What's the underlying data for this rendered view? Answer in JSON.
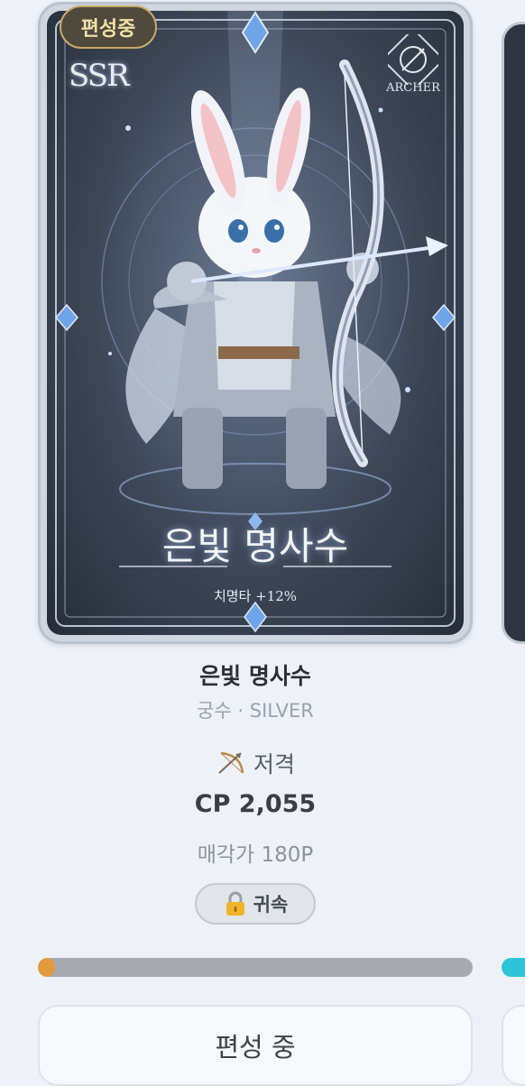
{
  "card": {
    "badge": "편성중",
    "rarity": "SSR",
    "class_label": "ARCHER",
    "art_name": "은빛 명사수",
    "art_stat": "치명타 +12%",
    "icons": {
      "class": "crossed-bow-icon",
      "skill": "bow-arrow-icon",
      "lock": "lock-icon"
    },
    "colors": {
      "badge_border": "#c9a969",
      "progress_fill": "#e29a3e",
      "next_progress_fill": "#2ec4d8"
    }
  },
  "info": {
    "name": "은빛 명사수",
    "subtitle": "궁수 · SILVER",
    "skill": "저격",
    "cp": "CP 2,055",
    "sell_price": "매각가 180P",
    "bound": "귀속"
  },
  "progress": {
    "value": 0.02
  },
  "action": {
    "label": "편성 중"
  }
}
